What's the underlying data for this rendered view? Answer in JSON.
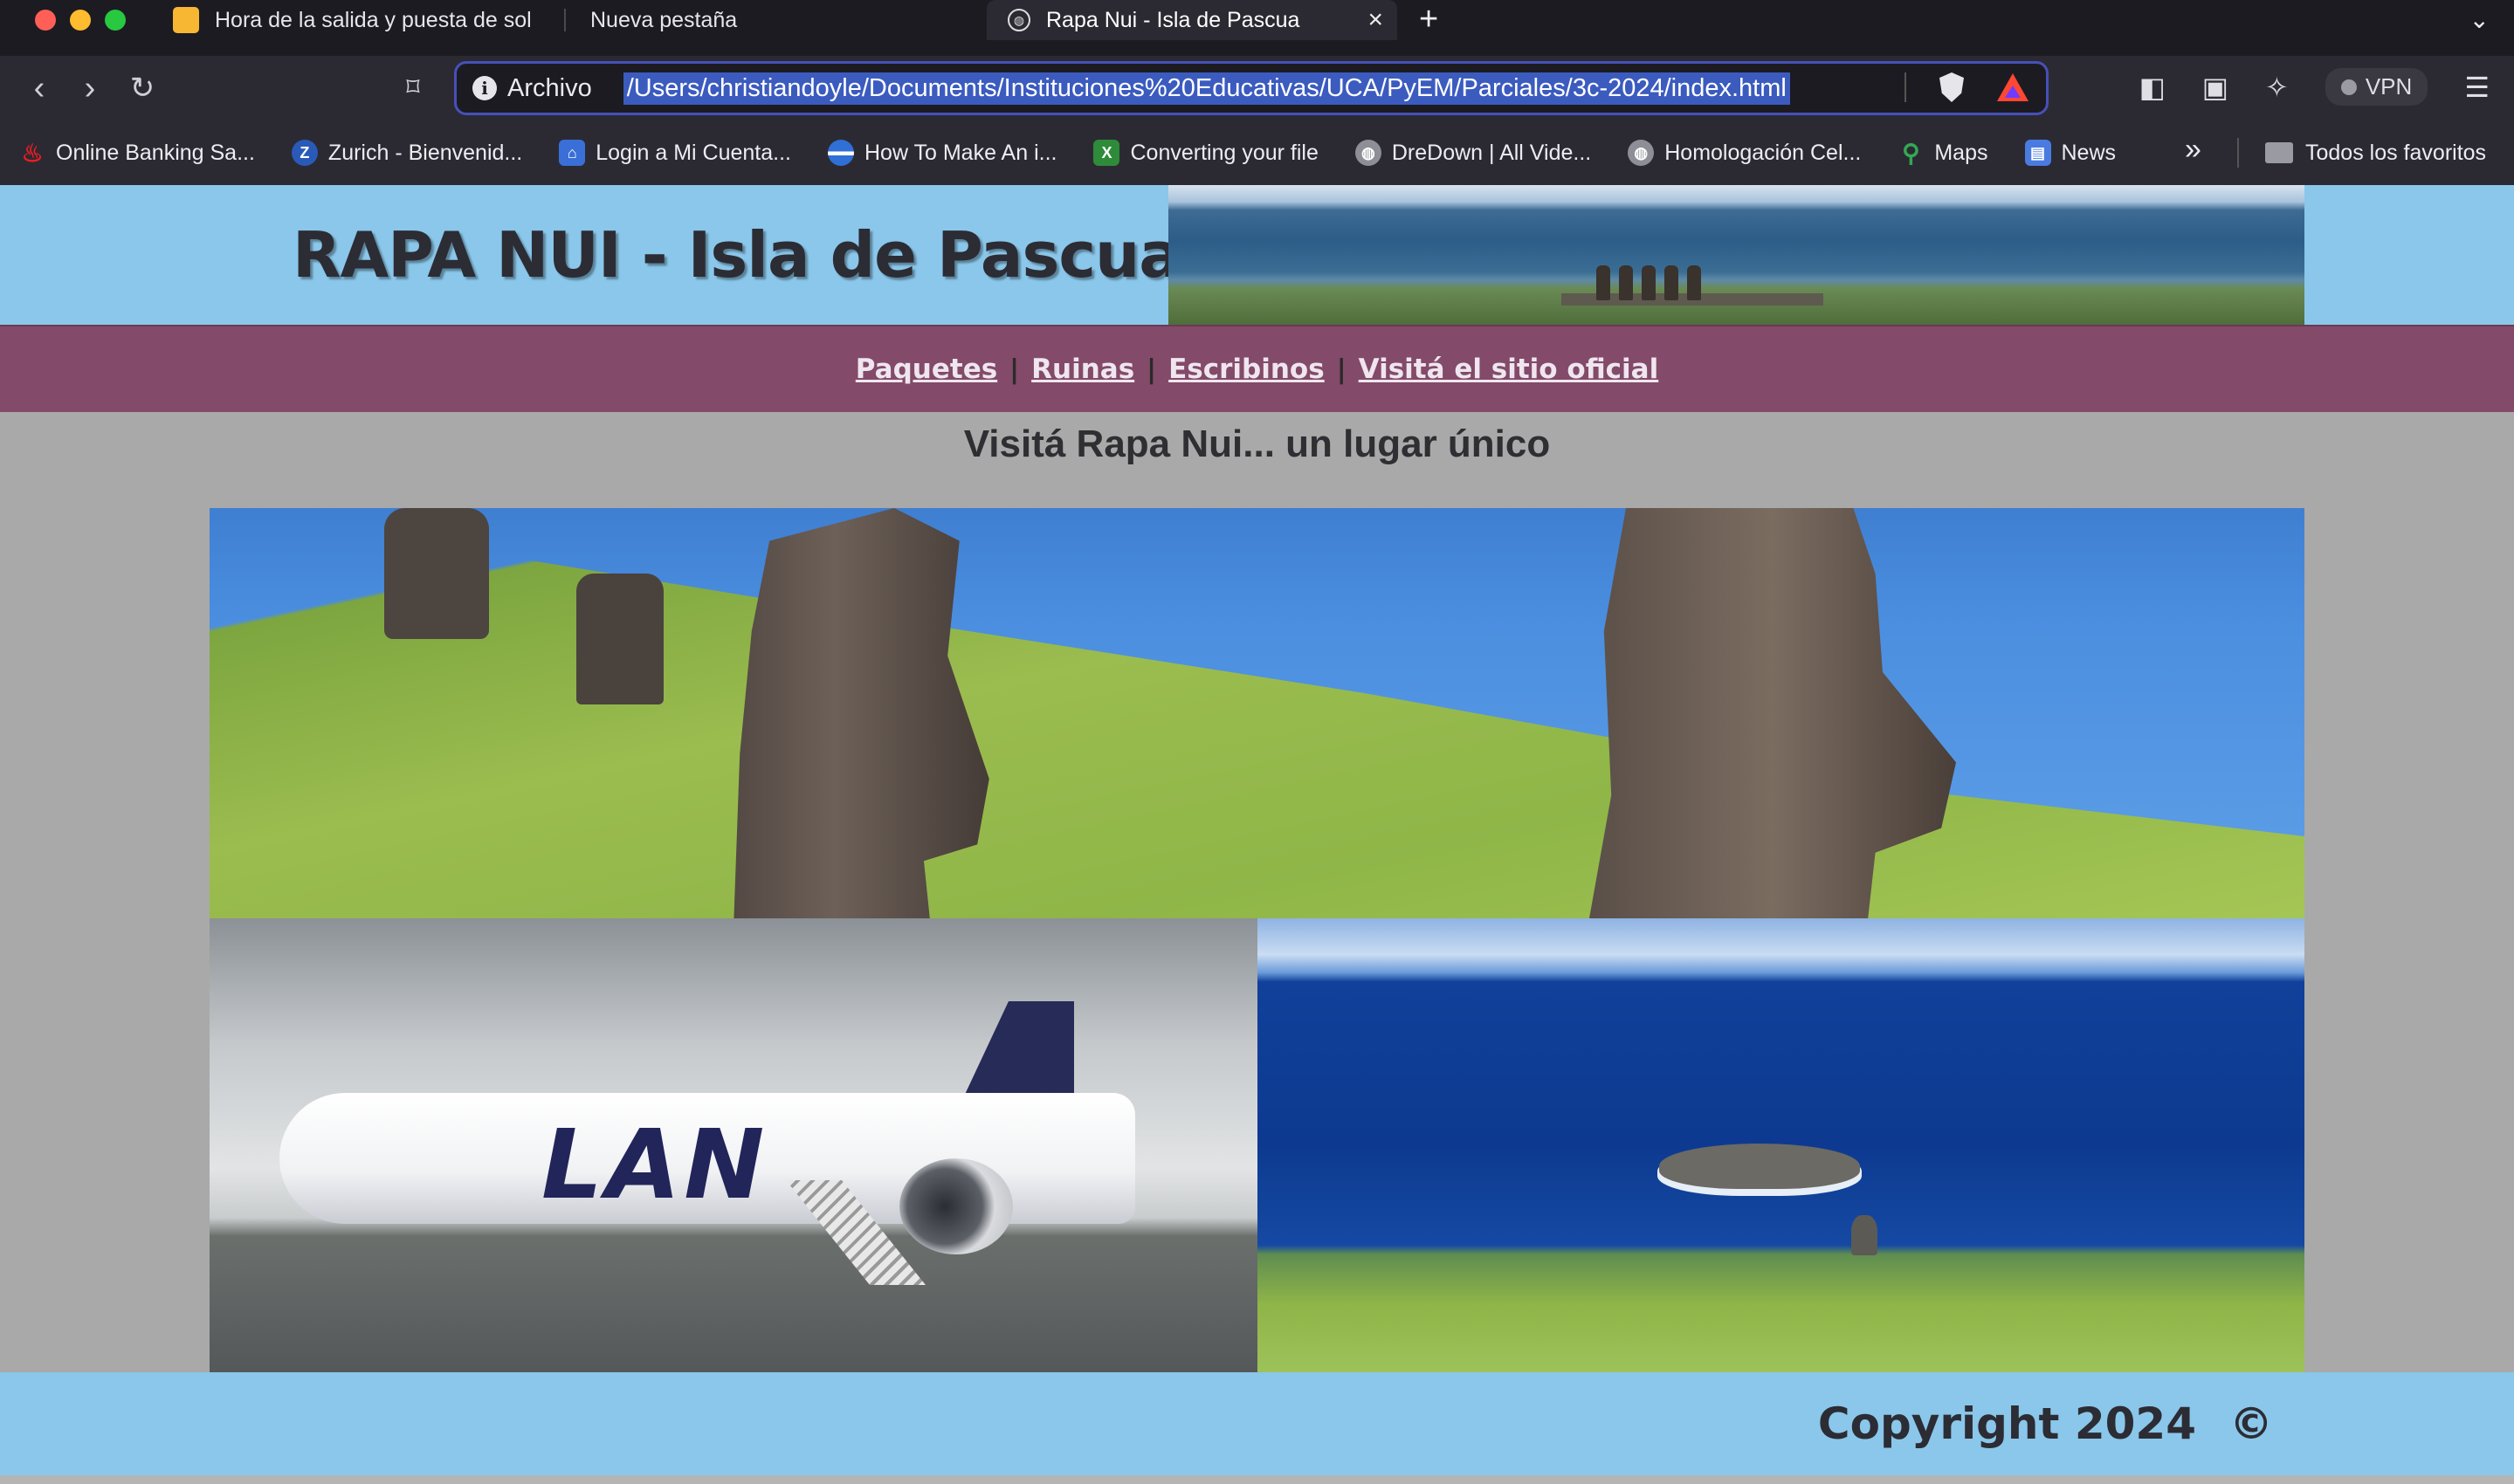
{
  "browser": {
    "tabs": [
      {
        "title": "Hora de la salida y puesta de sol"
      },
      {
        "title": "Nueva pestaña"
      },
      {
        "title": "Rapa Nui - Isla de Pascua",
        "active": true
      }
    ],
    "address": {
      "scheme_label": "Archivo",
      "url": "/Users/christiandoyle/Documents/Instituciones%20Educativas/UCA/PyEM/Parciales/3c-2024/index.html"
    },
    "vpn_label": "VPN",
    "bookmarks": [
      {
        "label": "Online Banking Sa...",
        "icon": "santander-icon",
        "color": "#ec1c24"
      },
      {
        "label": "Zurich - Bienvenid...",
        "icon": "zurich-icon",
        "color": "#2a5ab8"
      },
      {
        "label": "Login a Mi Cuenta...",
        "icon": "bank-icon",
        "color": "#3a6fd8"
      },
      {
        "label": "How To Make An i...",
        "icon": "globe-stripe-icon",
        "color": "#2f6fd6"
      },
      {
        "label": "Converting your file",
        "icon": "excel-icon",
        "color": "#2e8b3a"
      },
      {
        "label": "DreDown | All Vide...",
        "icon": "globe-icon",
        "color": "#8e8e96"
      },
      {
        "label": "Homologación Cel...",
        "icon": "globe-icon",
        "color": "#8e8e96"
      },
      {
        "label": "Maps",
        "icon": "maps-pin-icon",
        "color": "#34a853"
      },
      {
        "label": "News",
        "icon": "news-icon",
        "color": "#4a7be0"
      }
    ],
    "all_bookmarks_label": "Todos los favoritos"
  },
  "site": {
    "title": "RAPA NUI - Isla de Pascua",
    "nav": [
      {
        "label": "Paquetes"
      },
      {
        "label": "Ruinas"
      },
      {
        "label": "Escribinos"
      },
      {
        "label": "Visitá el sitio oficial"
      }
    ],
    "nav_separator": "|",
    "heading": "Visitá Rapa Nui... un lugar único",
    "footer": {
      "copyright": "Copyright 2024",
      "symbol": "©"
    },
    "colors": {
      "header_bg": "#8ac7ea",
      "nav_bg": "#834a69",
      "page_bg": "#a9a9a9"
    }
  }
}
